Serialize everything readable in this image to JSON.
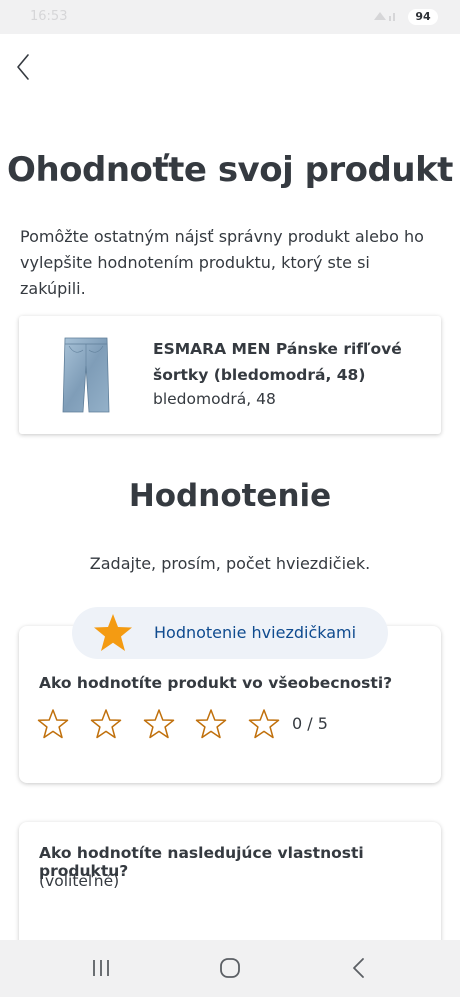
{
  "status_bar": {
    "time": "16:53",
    "battery": "94"
  },
  "page": {
    "title": "Ohodnoťte svoj produkt",
    "intro": "Pomôžte ostatným nájsť správny produkt alebo ho vylepšite hodnotením produktu, ktorý ste si zakúpili."
  },
  "product": {
    "name": "ESMARA MEN Pánske rifľové šortky (bledomodrá, 48)",
    "variant": "bledomodrá, 48",
    "image_icon": "denim-shorts-image"
  },
  "rating_section": {
    "title": "Hodnotenie",
    "hint": "Zadajte, prosím, počet hviezdičiek."
  },
  "star_rating": {
    "pill_label": "Hodnotenie hviezdičkami",
    "question": "Ako hodnotíte produkt vo všeobecnosti?",
    "rating_value": 0,
    "rating_max": 5,
    "score_text": "0 / 5"
  },
  "properties": {
    "question": "Ako hodnotíte nasledujúce vlastnosti produktu?",
    "optional": "(voliteľné)"
  },
  "colors": {
    "accent_star": "#f49b12",
    "star_outline": "#c0700c",
    "pill_bg": "#eef2f8",
    "link_blue": "#0f4b8f",
    "text": "#353a40"
  },
  "nav": {
    "recent_icon": "recent-apps-icon",
    "home_icon": "home-icon",
    "back_icon": "back-icon"
  }
}
